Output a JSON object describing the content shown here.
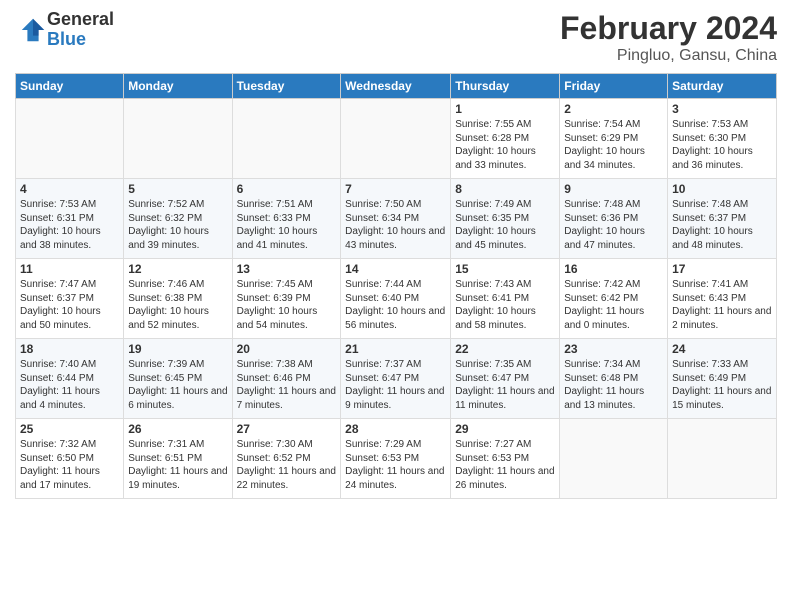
{
  "logo": {
    "general": "General",
    "blue": "Blue"
  },
  "title": "February 2024",
  "subtitle": "Pingluo, Gansu, China",
  "days_of_week": [
    "Sunday",
    "Monday",
    "Tuesday",
    "Wednesday",
    "Thursday",
    "Friday",
    "Saturday"
  ],
  "weeks": [
    [
      {
        "day": "",
        "info": ""
      },
      {
        "day": "",
        "info": ""
      },
      {
        "day": "",
        "info": ""
      },
      {
        "day": "",
        "info": ""
      },
      {
        "day": "1",
        "info": "Sunrise: 7:55 AM\nSunset: 6:28 PM\nDaylight: 10 hours and 33 minutes."
      },
      {
        "day": "2",
        "info": "Sunrise: 7:54 AM\nSunset: 6:29 PM\nDaylight: 10 hours and 34 minutes."
      },
      {
        "day": "3",
        "info": "Sunrise: 7:53 AM\nSunset: 6:30 PM\nDaylight: 10 hours and 36 minutes."
      }
    ],
    [
      {
        "day": "4",
        "info": "Sunrise: 7:53 AM\nSunset: 6:31 PM\nDaylight: 10 hours and 38 minutes."
      },
      {
        "day": "5",
        "info": "Sunrise: 7:52 AM\nSunset: 6:32 PM\nDaylight: 10 hours and 39 minutes."
      },
      {
        "day": "6",
        "info": "Sunrise: 7:51 AM\nSunset: 6:33 PM\nDaylight: 10 hours and 41 minutes."
      },
      {
        "day": "7",
        "info": "Sunrise: 7:50 AM\nSunset: 6:34 PM\nDaylight: 10 hours and 43 minutes."
      },
      {
        "day": "8",
        "info": "Sunrise: 7:49 AM\nSunset: 6:35 PM\nDaylight: 10 hours and 45 minutes."
      },
      {
        "day": "9",
        "info": "Sunrise: 7:48 AM\nSunset: 6:36 PM\nDaylight: 10 hours and 47 minutes."
      },
      {
        "day": "10",
        "info": "Sunrise: 7:48 AM\nSunset: 6:37 PM\nDaylight: 10 hours and 48 minutes."
      }
    ],
    [
      {
        "day": "11",
        "info": "Sunrise: 7:47 AM\nSunset: 6:37 PM\nDaylight: 10 hours and 50 minutes."
      },
      {
        "day": "12",
        "info": "Sunrise: 7:46 AM\nSunset: 6:38 PM\nDaylight: 10 hours and 52 minutes."
      },
      {
        "day": "13",
        "info": "Sunrise: 7:45 AM\nSunset: 6:39 PM\nDaylight: 10 hours and 54 minutes."
      },
      {
        "day": "14",
        "info": "Sunrise: 7:44 AM\nSunset: 6:40 PM\nDaylight: 10 hours and 56 minutes."
      },
      {
        "day": "15",
        "info": "Sunrise: 7:43 AM\nSunset: 6:41 PM\nDaylight: 10 hours and 58 minutes."
      },
      {
        "day": "16",
        "info": "Sunrise: 7:42 AM\nSunset: 6:42 PM\nDaylight: 11 hours and 0 minutes."
      },
      {
        "day": "17",
        "info": "Sunrise: 7:41 AM\nSunset: 6:43 PM\nDaylight: 11 hours and 2 minutes."
      }
    ],
    [
      {
        "day": "18",
        "info": "Sunrise: 7:40 AM\nSunset: 6:44 PM\nDaylight: 11 hours and 4 minutes."
      },
      {
        "day": "19",
        "info": "Sunrise: 7:39 AM\nSunset: 6:45 PM\nDaylight: 11 hours and 6 minutes."
      },
      {
        "day": "20",
        "info": "Sunrise: 7:38 AM\nSunset: 6:46 PM\nDaylight: 11 hours and 7 minutes."
      },
      {
        "day": "21",
        "info": "Sunrise: 7:37 AM\nSunset: 6:47 PM\nDaylight: 11 hours and 9 minutes."
      },
      {
        "day": "22",
        "info": "Sunrise: 7:35 AM\nSunset: 6:47 PM\nDaylight: 11 hours and 11 minutes."
      },
      {
        "day": "23",
        "info": "Sunrise: 7:34 AM\nSunset: 6:48 PM\nDaylight: 11 hours and 13 minutes."
      },
      {
        "day": "24",
        "info": "Sunrise: 7:33 AM\nSunset: 6:49 PM\nDaylight: 11 hours and 15 minutes."
      }
    ],
    [
      {
        "day": "25",
        "info": "Sunrise: 7:32 AM\nSunset: 6:50 PM\nDaylight: 11 hours and 17 minutes."
      },
      {
        "day": "26",
        "info": "Sunrise: 7:31 AM\nSunset: 6:51 PM\nDaylight: 11 hours and 19 minutes."
      },
      {
        "day": "27",
        "info": "Sunrise: 7:30 AM\nSunset: 6:52 PM\nDaylight: 11 hours and 22 minutes."
      },
      {
        "day": "28",
        "info": "Sunrise: 7:29 AM\nSunset: 6:53 PM\nDaylight: 11 hours and 24 minutes."
      },
      {
        "day": "29",
        "info": "Sunrise: 7:27 AM\nSunset: 6:53 PM\nDaylight: 11 hours and 26 minutes."
      },
      {
        "day": "",
        "info": ""
      },
      {
        "day": "",
        "info": ""
      }
    ]
  ]
}
